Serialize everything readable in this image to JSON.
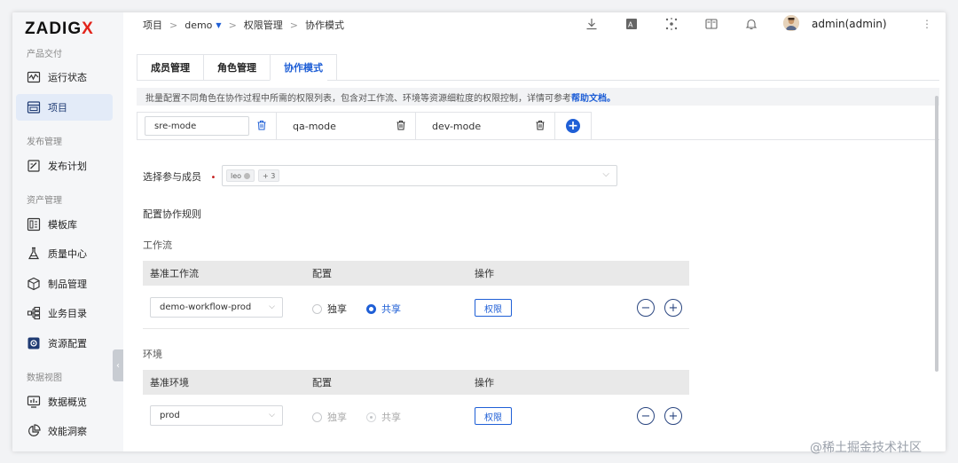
{
  "brand": {
    "logo_main": "ZADIG",
    "logo_x": "X"
  },
  "sidebar": {
    "sections": [
      {
        "title": "产品交付"
      },
      {
        "title": "发布管理"
      },
      {
        "title": "资产管理"
      },
      {
        "title": "数据视图"
      }
    ],
    "items": [
      {
        "label": "运行状态",
        "icon": "activity-icon"
      },
      {
        "label": "项目",
        "icon": "project-icon",
        "active": true
      },
      {
        "label": "发布计划",
        "icon": "release-plan-icon"
      },
      {
        "label": "模板库",
        "icon": "template-icon"
      },
      {
        "label": "质量中心",
        "icon": "flask-icon"
      },
      {
        "label": "制品管理",
        "icon": "package-icon"
      },
      {
        "label": "业务目录",
        "icon": "catalog-icon"
      },
      {
        "label": "资源配置",
        "icon": "gear-icon"
      },
      {
        "label": "数据概览",
        "icon": "dashboard-icon"
      },
      {
        "label": "效能洞察",
        "icon": "pie-chart-icon"
      }
    ]
  },
  "header": {
    "breadcrumb": [
      "项目",
      "demo",
      "权限管理",
      "协作模式"
    ],
    "user": "admin(admin)"
  },
  "tabs": [
    {
      "label": "成员管理"
    },
    {
      "label": "角色管理"
    },
    {
      "label": "协作模式",
      "active": true
    }
  ],
  "description": {
    "text": "批量配置不同角色在协作过程中所需的权限列表，包含对工作流、环境等资源细粒度的权限控制，详情可参考 ",
    "link": "帮助文档。"
  },
  "modes": [
    {
      "name": "sre-mode"
    },
    {
      "name": "qa-mode"
    },
    {
      "name": "dev-mode"
    }
  ],
  "form": {
    "members_label": "选择参与成员",
    "required_mark": "•",
    "member_chip": "leo",
    "member_more": "+ 3",
    "rules_title": "配置协作规则",
    "workflow_section": "工作流",
    "env_section": "环境"
  },
  "workflow_table": {
    "headers": [
      "基准工作流",
      "配置",
      "操作"
    ],
    "rows": [
      {
        "value": "demo-workflow-prod",
        "opt_exclusive": "独享",
        "opt_shared": "共享",
        "selected": "shared",
        "action": "权限"
      }
    ]
  },
  "env_table": {
    "headers": [
      "基准环境",
      "配置",
      "操作"
    ],
    "rows": [
      {
        "value": "prod",
        "opt_exclusive": "独享",
        "opt_shared": "共享",
        "selected": "shared",
        "disabled": true,
        "action": "权限"
      }
    ]
  },
  "watermark": "@稀土掘金技术社区",
  "colors": {
    "accent": "#1f5fd6",
    "logo_x": "#e2231a",
    "active_nav_bg": "#e3ebf8"
  }
}
